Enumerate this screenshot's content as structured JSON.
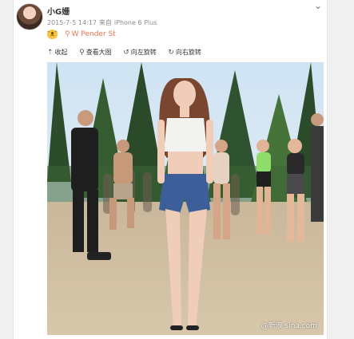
{
  "post": {
    "username": "小G姗",
    "date": "2015-7-5 14:17",
    "source_prefix": "来自",
    "source": "iPhone 6 Plus",
    "location": "W Pender St",
    "emoji_icon": "smiley-cat-emoji"
  },
  "toolbar": {
    "collapse_label": "收起",
    "view_large_label": "查看大图",
    "rotate_left_label": "向左旋转",
    "rotate_right_label": "向右旋转"
  },
  "photo": {
    "watermark": "@新浪 sina.com"
  },
  "colors": {
    "location": "#eb7350",
    "meta": "#8c8c8c"
  }
}
